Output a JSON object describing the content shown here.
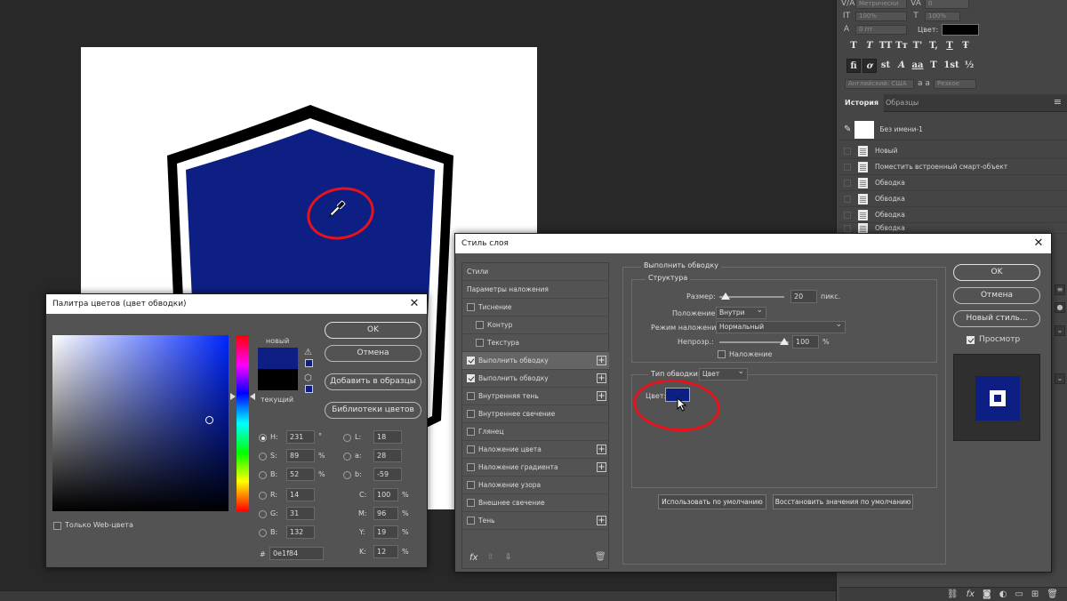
{
  "character_panel": {
    "font_method": "Метрически",
    "tracking_value": "0",
    "vscale": "100%",
    "hscale": "100%",
    "baseline": "0 пт",
    "color_label": "Цвет:",
    "color_value": "#000000",
    "language": "Английский: США",
    "aa_label": "a a",
    "aa_mode": "Резкое",
    "type_buttons": [
      "T",
      "T",
      "TT",
      "Tт",
      "T'",
      "T,",
      "T",
      "Ŧ"
    ],
    "opentype_buttons": [
      "fi",
      "ơ",
      "st",
      "A",
      "aa",
      "T",
      "1st",
      "½"
    ]
  },
  "history": {
    "tabs": [
      "История",
      "Образцы"
    ],
    "snapshot_label": "Без имени-1",
    "items": [
      "Новый",
      "Поместить встроенный смарт-объект",
      "Обводка",
      "Обводка",
      "Обводка",
      "Обводка"
    ]
  },
  "layers_bottom_icons": [
    "link-icon",
    "fx-icon",
    "mask-icon",
    "adjustment-icon",
    "folder-icon",
    "new-layer-icon",
    "trash-icon"
  ],
  "color_picker": {
    "title": "Палитра цветов (цвет обводки)",
    "new_label": "новый",
    "current_label": "текущий",
    "new_color": "#0e1f84",
    "current_color": "#000000",
    "ok": "OK",
    "cancel": "Отмена",
    "add_to_swatches": "Добавить в образцы",
    "color_libraries": "Библиотеки цветов",
    "web_only": "Только Web-цвета",
    "hsb": [
      {
        "label": "H:",
        "value": "231",
        "unit": "°",
        "selected": true
      },
      {
        "label": "S:",
        "value": "89",
        "unit": "%",
        "selected": false
      },
      {
        "label": "B:",
        "value": "52",
        "unit": "%",
        "selected": false
      }
    ],
    "rgb": [
      {
        "label": "R:",
        "value": "14"
      },
      {
        "label": "G:",
        "value": "31"
      },
      {
        "label": "B:",
        "value": "132"
      }
    ],
    "lab": [
      {
        "label": "L:",
        "value": "18"
      },
      {
        "label": "a:",
        "value": "28"
      },
      {
        "label": "b:",
        "value": "-59"
      }
    ],
    "cmyk": [
      {
        "label": "C:",
        "value": "100",
        "unit": "%"
      },
      {
        "label": "M:",
        "value": "96",
        "unit": "%"
      },
      {
        "label": "Y:",
        "value": "19",
        "unit": "%"
      },
      {
        "label": "K:",
        "value": "12",
        "unit": "%"
      }
    ],
    "hex_label": "#",
    "hex": "0e1f84"
  },
  "layer_style": {
    "title": "Стиль слоя",
    "styles": [
      {
        "label": "Стили",
        "check": false,
        "indent": false,
        "plus": false,
        "hascheck": false
      },
      {
        "label": "Параметры наложения",
        "check": false,
        "indent": false,
        "plus": false,
        "hascheck": false
      },
      {
        "label": "Тиснение",
        "check": false,
        "indent": false,
        "plus": false,
        "hascheck": true
      },
      {
        "label": "Контур",
        "check": false,
        "indent": true,
        "plus": false,
        "hascheck": true
      },
      {
        "label": "Текстура",
        "check": false,
        "indent": true,
        "plus": false,
        "hascheck": true
      },
      {
        "label": "Выполнить обводку",
        "check": true,
        "indent": false,
        "plus": true,
        "hascheck": true
      },
      {
        "label": "Выполнить обводку",
        "check": true,
        "indent": false,
        "plus": true,
        "hascheck": true
      },
      {
        "label": "Внутренняя тень",
        "check": false,
        "indent": false,
        "plus": true,
        "hascheck": true
      },
      {
        "label": "Внутреннее свечение",
        "check": false,
        "indent": false,
        "plus": false,
        "hascheck": true
      },
      {
        "label": "Глянец",
        "check": false,
        "indent": false,
        "plus": false,
        "hascheck": true
      },
      {
        "label": "Наложение цвета",
        "check": false,
        "indent": false,
        "plus": true,
        "hascheck": true
      },
      {
        "label": "Наложение градиента",
        "check": false,
        "indent": false,
        "plus": true,
        "hascheck": true
      },
      {
        "label": "Наложение узора",
        "check": false,
        "indent": false,
        "plus": false,
        "hascheck": true
      },
      {
        "label": "Внешнее свечение",
        "check": false,
        "indent": false,
        "plus": false,
        "hascheck": true
      },
      {
        "label": "Тень",
        "check": false,
        "indent": false,
        "plus": true,
        "hascheck": true
      }
    ],
    "section_title": "Выполнить обводку",
    "structure_title": "Структура",
    "size_label": "Размер:",
    "size_value": "20",
    "size_unit": "пикс.",
    "position_label": "Положение:",
    "position_value": "Внутри",
    "blend_label": "Режим наложения:",
    "blend_value": "Нормальный",
    "opacity_label": "Непрозр.:",
    "opacity_value": "100",
    "opacity_unit": "%",
    "overprint_label": "Наложение",
    "fill_type_label": "Тип обводки:",
    "fill_type_value": "Цвет",
    "color_label": "Цвет:",
    "stroke_color": "#0e1f84",
    "make_default": "Использовать по умолчанию",
    "reset_default": "Восстановить значения по умолчанию",
    "ok": "OK",
    "cancel": "Отмена",
    "new_style": "Новый стиль...",
    "preview_label": "Просмотр",
    "preview_checked": true
  },
  "colors": {
    "shield_fill": "#0e1f84",
    "annotation_red": "#e8121c",
    "dialog_bg": "#535353",
    "workspace_bg": "#282828"
  }
}
